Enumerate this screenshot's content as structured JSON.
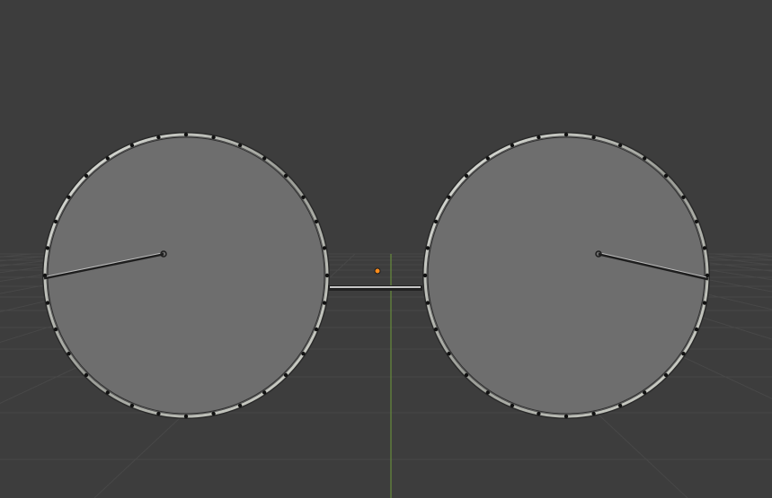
{
  "viewport": {
    "background": "#3d3d3d",
    "view": "perspective"
  },
  "floor_grid": {
    "visible": true,
    "line_color": "#484848",
    "y_axis_color": "#6e9a3a"
  },
  "objects": [
    {
      "name": "left-lens",
      "type": "lens-with-wire-frame",
      "fill": "#6e6e6e",
      "frame_color": "#c9cbc6"
    },
    {
      "name": "right-lens",
      "type": "lens-with-wire-frame",
      "fill": "#6e6e6e",
      "frame_color": "#c9cbc6"
    },
    {
      "name": "bridge",
      "type": "bar",
      "color": "#c6c6c6"
    }
  ],
  "origin_marker": {
    "color": "#ff8c1a"
  }
}
